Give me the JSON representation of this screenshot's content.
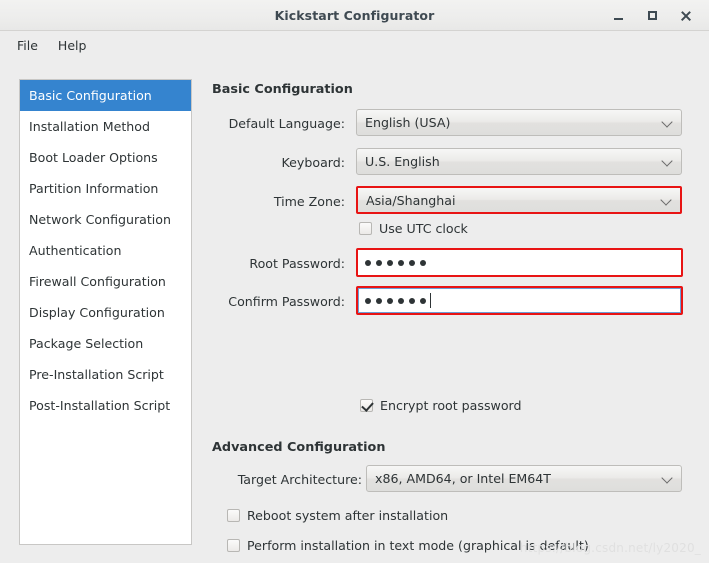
{
  "window": {
    "title": "Kickstart Configurator",
    "controls": {
      "minimize": "minimize",
      "maximize": "maximize",
      "close": "close"
    }
  },
  "menubar": {
    "items": [
      {
        "label": "File"
      },
      {
        "label": "Help"
      }
    ]
  },
  "sidebar": {
    "items": [
      {
        "label": "Basic Configuration",
        "selected": true
      },
      {
        "label": "Installation Method",
        "selected": false
      },
      {
        "label": "Boot Loader Options",
        "selected": false
      },
      {
        "label": "Partition Information",
        "selected": false
      },
      {
        "label": "Network Configuration",
        "selected": false
      },
      {
        "label": "Authentication",
        "selected": false
      },
      {
        "label": "Firewall Configuration",
        "selected": false
      },
      {
        "label": "Display Configuration",
        "selected": false
      },
      {
        "label": "Package Selection",
        "selected": false
      },
      {
        "label": "Pre-Installation Script",
        "selected": false
      },
      {
        "label": "Post-Installation Script",
        "selected": false
      }
    ]
  },
  "main": {
    "basic_section": {
      "heading": "Basic Configuration",
      "default_language": {
        "label": "Default Language:",
        "value": "English (USA)"
      },
      "keyboard": {
        "label": "Keyboard:",
        "value": "U.S. English"
      },
      "time_zone": {
        "label": "Time Zone:",
        "value": "Asia/Shanghai",
        "highlighted": true
      },
      "use_utc_clock": {
        "label": "Use UTC clock",
        "checked": false
      },
      "root_password": {
        "label": "Root Password:",
        "value": "••••••",
        "masked_char_count": 6,
        "highlighted": true,
        "focused": false
      },
      "confirm_password": {
        "label": "Confirm Password:",
        "value": "••••••",
        "masked_char_count": 6,
        "highlighted": true,
        "focused": true
      },
      "encrypt_root_password": {
        "label": "Encrypt root password",
        "checked": true
      }
    },
    "advanced_section": {
      "heading": "Advanced Configuration",
      "target_architecture": {
        "label": "Target Architecture:",
        "value": "x86, AMD64, or Intel EM64T"
      },
      "reboot_after_install": {
        "label": "Reboot system after installation",
        "checked": false
      },
      "text_mode_install": {
        "label": "Perform installation in text mode (graphical is default)",
        "checked": false
      }
    }
  },
  "watermark": {
    "text": "https://blog.csdn.net/ly2020_"
  },
  "colors": {
    "accent_selected": "#3584cf",
    "highlight_border": "#e81414",
    "window_bg": "#ededed",
    "panel_bg": "#ffffff",
    "text": "#2e3436"
  }
}
